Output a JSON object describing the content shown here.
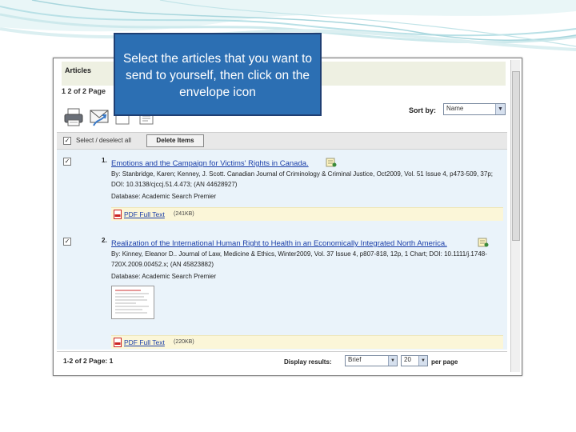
{
  "callout": {
    "text": "Select the articles that you want to send to yourself, then click on the envelope icon"
  },
  "panel": {
    "title": "Articles",
    "pager_top": "1 2 of 2 Page",
    "sort_label": "Sort by:",
    "sort_value": "Name",
    "select_label": "Select / deselect all",
    "delete_label": "Delete Items",
    "toolbar_icons": [
      "printer-icon",
      "envelope-icon",
      "save-icon",
      "export-icon"
    ]
  },
  "results": [
    {
      "num": "1.",
      "title": "Emotions and the Campaign for Victims' Rights in Canada.",
      "meta": "By: Stanbridge, Karen; Kenney, J. Scott. Canadian Journal of Criminology & Criminal Justice, Oct2009, Vol. 51 Issue 4, p473-509, 37p; DOI: 10.3138/cjccj.51.4.473; (AN 44628927)",
      "database": "Database: Academic Search Premier",
      "pdf_label": "PDF Full Text",
      "pdf_size": "(241KB)",
      "checked": true
    },
    {
      "num": "2.",
      "title": "Realization of the International Human Right to Health in an Economically Integrated North America.",
      "meta": "By: Kinney, Eleanor D.. Journal of Law, Medicine & Ethics, Winter2009, Vol. 37 Issue 4, p807-818, 12p, 1 Chart; DOI: 10.1111/j.1748-720X.2009.00452.x; (AN 45823882)",
      "database": "Database: Academic Search Premier",
      "pdf_label": "PDF Full Text",
      "pdf_size": "(220KB)",
      "checked": true
    }
  ],
  "footer": {
    "pager": "1-2 of 2  Page: 1",
    "display_label": "Display results:",
    "display_mode": "Brief",
    "per_page_value": "20",
    "per_page_label": "per page"
  },
  "colors": {
    "callout_bg": "#2c6fb3",
    "link": "#1a3ea8",
    "results_bg": "#eaf3fa"
  }
}
